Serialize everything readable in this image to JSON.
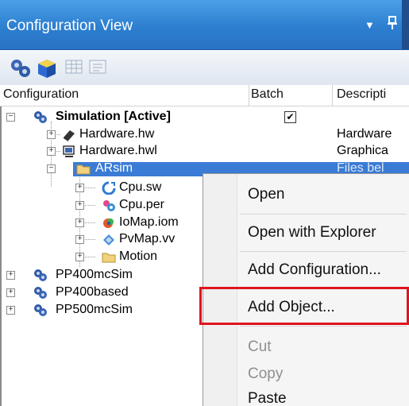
{
  "window": {
    "title": "Configuration View"
  },
  "titlebar": {
    "dropdown_icon": "dropdown-arrow-icon",
    "pin_icon": "pin-icon"
  },
  "toolbar": {
    "buttons": [
      "configuration-tool-icon",
      "cube-icon",
      "grid-icon",
      "list-icon"
    ]
  },
  "columns": {
    "configuration": "Configuration",
    "batch": "Batch",
    "description": "Descripti"
  },
  "tree": {
    "simulation": {
      "label": "Simulation [Active]",
      "batch_checked": "✔"
    },
    "hardware_hw": {
      "label": "Hardware.hw",
      "desc": "Hardware"
    },
    "hardware_hwl": {
      "label": "Hardware.hwl",
      "desc": "Graphica"
    },
    "arsim": {
      "label": "ARsim",
      "desc": "Files bel"
    },
    "cpu_sw": {
      "label": "Cpu.sw"
    },
    "cpu_per": {
      "label": "Cpu.per"
    },
    "iomap": {
      "label": "IoMap.iom"
    },
    "pvmap": {
      "label": "PvMap.vv"
    },
    "motion": {
      "label": "Motion"
    },
    "pp400mcsim": {
      "label": "PP400mcSim"
    },
    "pp400based": {
      "label": "PP400based"
    },
    "pp500mcsim": {
      "label": "PP500mcSim"
    }
  },
  "context_menu": {
    "open": "Open",
    "open_with_explorer": "Open with Explorer",
    "add_configuration": "Add Configuration...",
    "add_object": "Add Object...",
    "cut": "Cut",
    "copy": "Copy",
    "paste": "Paste"
  },
  "colors": {
    "titlebar": "#2d7fd0",
    "selection": "#3a7bd5",
    "highlight": "#e0141e"
  }
}
